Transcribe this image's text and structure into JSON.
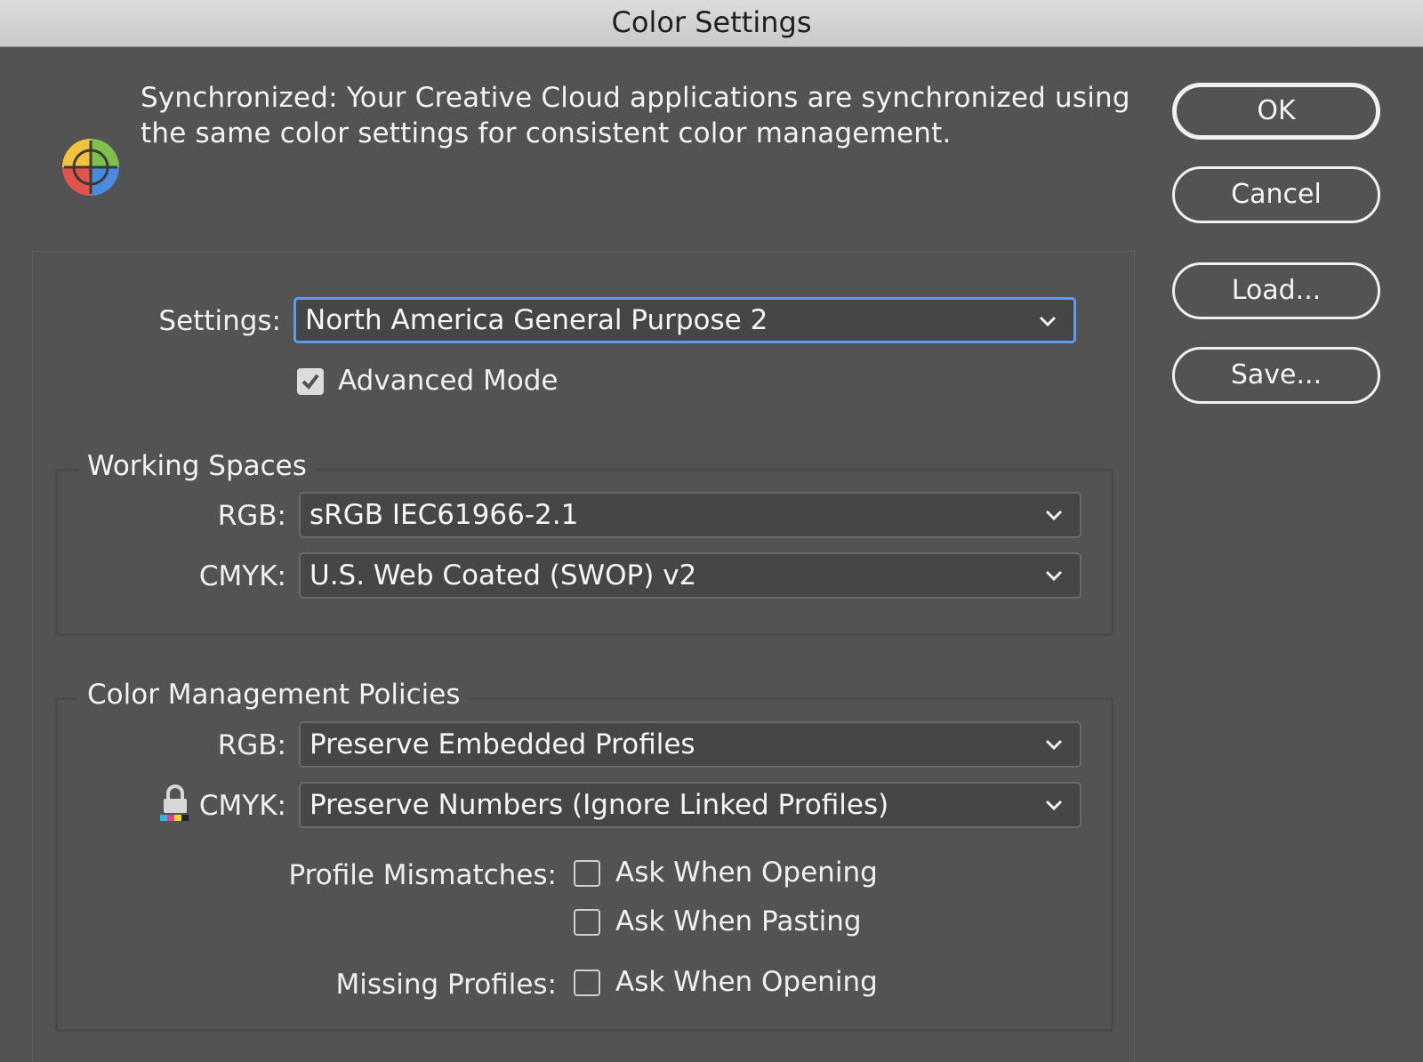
{
  "window": {
    "title": "Color Settings"
  },
  "sync_message": "Synchronized: Your Creative Cloud applications are synchronized using the same color settings for consistent color management.",
  "buttons": {
    "ok": "OK",
    "cancel": "Cancel",
    "load": "Load...",
    "save": "Save..."
  },
  "settings": {
    "label": "Settings:",
    "value": "North America General Purpose 2",
    "advanced_mode": {
      "label": "Advanced Mode",
      "checked": true
    }
  },
  "working_spaces": {
    "title": "Working Spaces",
    "rgb": {
      "label": "RGB:",
      "value": "sRGB IEC61966-2.1"
    },
    "cmyk": {
      "label": "CMYK:",
      "value": "U.S. Web Coated (SWOP) v2"
    }
  },
  "policies": {
    "title": "Color Management Policies",
    "rgb": {
      "label": "RGB:",
      "value": "Preserve Embedded Profiles"
    },
    "cmyk": {
      "label": "CMYK:",
      "value": "Preserve Numbers (Ignore Linked Profiles)"
    },
    "profile_mismatches": {
      "label": "Profile Mismatches:",
      "ask_opening": {
        "label": "Ask When Opening",
        "checked": false
      },
      "ask_pasting": {
        "label": "Ask When Pasting",
        "checked": false
      }
    },
    "missing_profiles": {
      "label": "Missing Profiles:",
      "ask_opening": {
        "label": "Ask When Opening",
        "checked": false
      }
    }
  },
  "colors": {
    "focus_accent": "#5b9cf1",
    "background": "#535353"
  }
}
